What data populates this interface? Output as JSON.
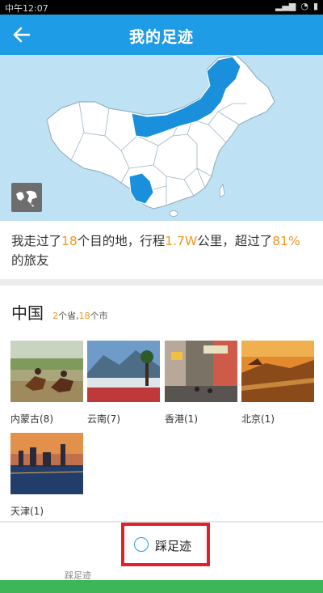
{
  "status_bar": {
    "time": "中午12:07"
  },
  "header": {
    "title": "我的足迹"
  },
  "stats": {
    "prefix": "我走过了",
    "destinations": "18",
    "mid1": "个目的地，行程",
    "distance": "1.7W",
    "mid2": "公里，超过了",
    "percent": "81%",
    "suffix": "的旅友"
  },
  "country": {
    "name": "中国",
    "count_provinces": "2",
    "count_mid": "个省,",
    "count_cities": "18",
    "count_suffix": "个市"
  },
  "places": [
    {
      "label": "内蒙古(8)"
    },
    {
      "label": "云南(7)"
    },
    {
      "label": "香港(1)"
    },
    {
      "label": "北京(1)"
    },
    {
      "label": "天津(1)"
    }
  ],
  "action": {
    "step_label": "踩足迹",
    "bottom_hint": "踩足迹"
  },
  "colors": {
    "accent": "#1f9ce6",
    "highlight": "#f0961e",
    "map_bg": "#bee1f3",
    "annotation": "#e0202a"
  }
}
